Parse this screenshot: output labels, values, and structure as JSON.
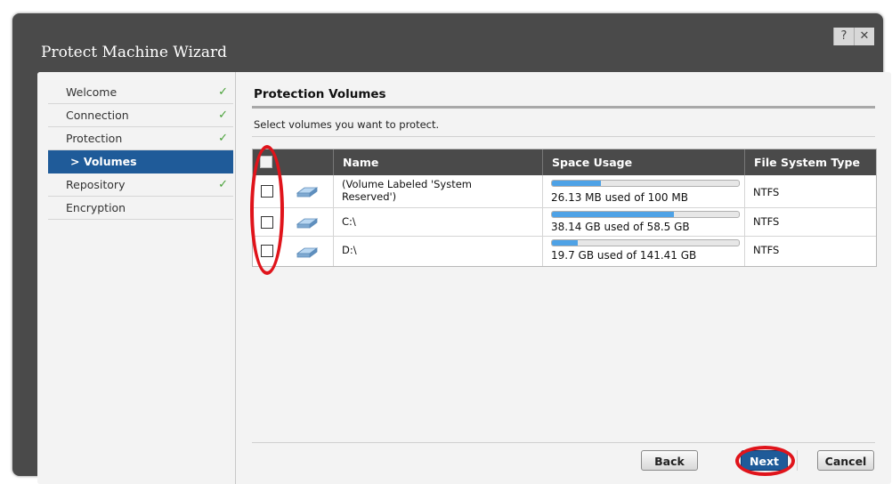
{
  "window": {
    "title": "Protect Machine Wizard",
    "help_label": "?",
    "close_label": "✕"
  },
  "steps": [
    {
      "label": "Welcome",
      "done": true
    },
    {
      "label": "Connection",
      "done": true
    },
    {
      "label": "Protection",
      "done": true
    },
    {
      "label": "> Volumes",
      "active": true
    },
    {
      "label": "Repository",
      "done": true
    },
    {
      "label": "Encryption",
      "done": false
    }
  ],
  "check_glyph": "✓",
  "main": {
    "title": "Protection Volumes",
    "instruction": "Select volumes you want to protect."
  },
  "table": {
    "headers": {
      "name": "Name",
      "space": "Space Usage",
      "fs": "File System Type"
    },
    "rows": [
      {
        "name": "(Volume Labeled 'System Reserved')",
        "usage": "26.13 MB used of 100 MB",
        "fill": 0.26,
        "fs": "NTFS"
      },
      {
        "name": "C:\\",
        "usage": "38.14 GB used of 58.5 GB",
        "fill": 0.65,
        "fs": "NTFS"
      },
      {
        "name": "D:\\",
        "usage": "19.7 GB used of 141.41 GB",
        "fill": 0.14,
        "fs": "NTFS"
      }
    ]
  },
  "buttons": {
    "back": "Back",
    "next": "Next",
    "cancel": "Cancel"
  },
  "colors": {
    "accent": "#1f5b99",
    "check": "#4aa23a",
    "annotation": "#e0141b",
    "bar": "#4ea2e6"
  },
  "icons": {
    "disk": "disk-drive-icon",
    "check": "checkmark-icon"
  }
}
